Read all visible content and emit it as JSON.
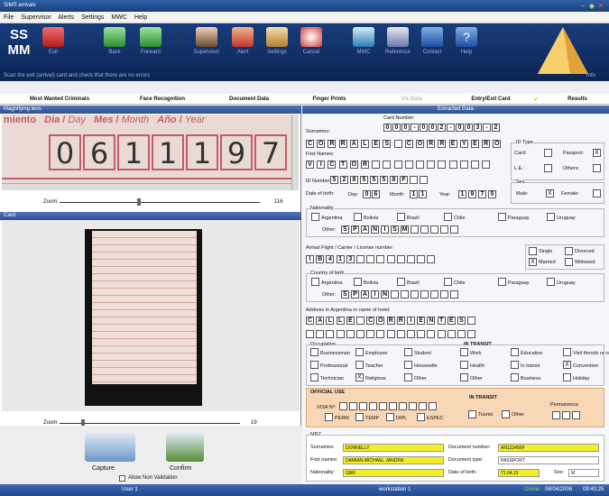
{
  "window": {
    "title": "SIMS arrivals"
  },
  "menu": [
    "File",
    "Supervisor",
    "Alerts",
    "Settings",
    "MWC",
    "Help"
  ],
  "toolbar": {
    "buttons": [
      "Exit",
      "Back",
      "Forward",
      "Supervisor",
      "Alert",
      "Settings",
      "Cancel",
      "MWC",
      "Reference",
      "Contact",
      "Help"
    ],
    "hint": "Scan the exit (arrival) card and check that there are no errors",
    "info": "Info"
  },
  "tabs": [
    "Most Wanted Criminals",
    "Face Recognition",
    "Document Data",
    "Finger Prints",
    "Vis Data",
    "Entry/Exit Card",
    "Results"
  ],
  "magnifier": {
    "title": "Magnifying lens",
    "header_text": [
      "miento",
      "Dia",
      "Day",
      "Mes",
      "Month",
      "Año",
      "Year"
    ],
    "digits": "0611197",
    "zoom_label": "Zoom",
    "zoom_value": "116"
  },
  "card": {
    "title": "Card",
    "zoom_label": "Zoom",
    "zoom_value": "19",
    "capture": "Capture",
    "confirm": "Confirm",
    "allow": "Allow Non Validation"
  },
  "extracted": {
    "title": "Extracted Data",
    "card_number_label": "Card Number:",
    "card_number": [
      "0",
      "0",
      "0",
      "-",
      "0",
      "0",
      "2",
      "-",
      "0",
      "0",
      "3",
      "-",
      "2"
    ],
    "surnames_label": "Surnames:",
    "surnames": [
      "C",
      "O",
      "R",
      "R",
      "A",
      "L",
      "E",
      "S",
      "",
      "C",
      "O",
      "R",
      "R",
      "E",
      "Y",
      "E",
      "R",
      "O"
    ],
    "first_names_label": "First Names:",
    "first_names": [
      "V",
      "I",
      "C",
      "T",
      "O",
      "R",
      "",
      "",
      "",
      "",
      "",
      "",
      "",
      "",
      "",
      "",
      ""
    ],
    "id_type_label": "ID Type",
    "card": "Card:",
    "passport": "Passport:",
    "le": "L.E.:",
    "others": "Others:",
    "id_number_label": "ID Number:",
    "id_number": [
      "5",
      "2",
      "8",
      "5",
      "5",
      "5",
      "8",
      "F",
      "",
      ""
    ],
    "dob_label": "Date of birth:",
    "day": "Day:",
    "day_val": [
      "0",
      "6"
    ],
    "month": "Month:",
    "month_val": [
      "1",
      "1"
    ],
    "year": "Year:",
    "year_val": [
      "1",
      "9",
      "7",
      "5"
    ],
    "sex_label": "Sex",
    "male": "Male:",
    "female": "Female:",
    "nationality_label": "Nationality",
    "countries": [
      "Argentina",
      "Bolivia",
      "Brazil",
      "Chile",
      "Paraguay",
      "Uruguay"
    ],
    "other": "Other:",
    "nat_other": [
      "S",
      "P",
      "A",
      "N",
      "I",
      "S",
      "M",
      "",
      "",
      "",
      "",
      ""
    ],
    "flight_label": "Arrival Flight / Carrier / License number:",
    "flight": [
      "I",
      "B",
      "4",
      "1",
      "3",
      "",
      "",
      "",
      "",
      "",
      "",
      "",
      ""
    ],
    "single": "Single",
    "divorced": "Divorced",
    "married": "Married",
    "widowed": "Widowed",
    "cob_label": "Country of birth",
    "cob_other": [
      "S",
      "P",
      "A",
      "I",
      "N",
      "",
      "",
      "",
      "",
      "",
      "",
      ""
    ],
    "address_label": "Address in Argentina or name of hotel:",
    "address": [
      "C",
      "A",
      "L",
      "L",
      "E",
      "",
      "C",
      "O",
      "R",
      "R",
      "I",
      "E",
      "N",
      "T",
      "E",
      "S",
      ""
    ],
    "occupation_label": "Occupation",
    "occupations": [
      "Businessman",
      "Employee",
      "Student",
      "Professional",
      "Teacher",
      "Housewife",
      "Technician",
      "Religious",
      "Other"
    ],
    "transit_label": "IN TRANSIT",
    "purposes": [
      "Work",
      "Health",
      "Other",
      "Education",
      "In transit",
      "Business",
      "Visit friends or relatives",
      "Convention",
      "Holiday"
    ],
    "official_label": "OFFICIAL USE",
    "visa_label": "VISA Nº:",
    "visa_types": [
      "PERM",
      "TEMP",
      "DIPL",
      "ESPEC"
    ],
    "in_transit": "IN TRANSIT",
    "tourist": "Tourist",
    "other2": "Other",
    "permanence": "Permanence"
  },
  "mrz": {
    "title": "MRZ",
    "surnames_label": "Surnames:",
    "surnames": "DONNELLY",
    "firstnames_label": "First names:",
    "firstnames": "DAMIAN MICHAEL JANDRA",
    "nationality_label": "Nationality:",
    "nationality": "GBR",
    "docnum_label": "Document number:",
    "docnum": "AN123456F",
    "doctype_label": "Document type:",
    "doctype": "PASSPORT",
    "dob_label": "Date of birth:",
    "dob": "71.04.15",
    "sex_label": "Sex:",
    "sex": "M"
  },
  "status": {
    "user": "User 1",
    "workstation": "workstation 1",
    "online": "Online",
    "date": "06/04/2006",
    "time": "09:40:25"
  }
}
